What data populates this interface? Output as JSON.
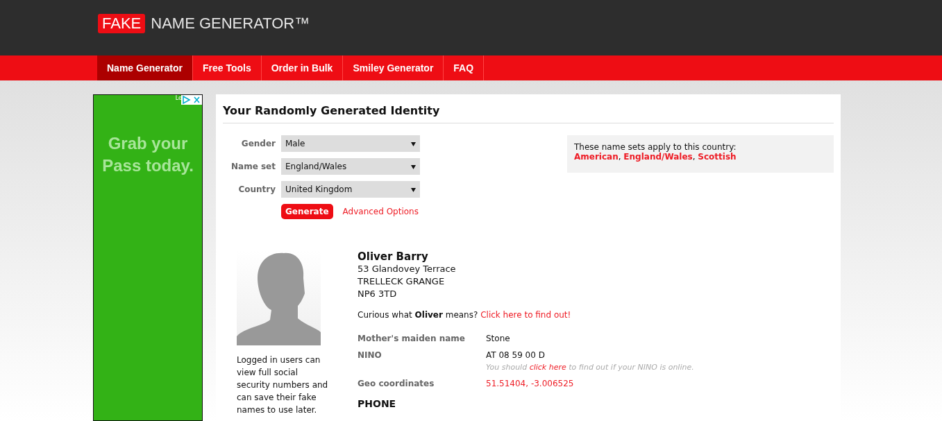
{
  "header": {
    "logo_badge": "FAKE",
    "logo_text": "NAME GENERATOR™"
  },
  "nav": [
    {
      "label": "Name Generator",
      "selected": true
    },
    {
      "label": "Free Tools",
      "selected": false
    },
    {
      "label": "Order in Bulk",
      "selected": false
    },
    {
      "label": "Smiley Generator",
      "selected": false
    },
    {
      "label": "FAQ",
      "selected": false
    }
  ],
  "ad": {
    "label": "Le",
    "headline": "Grab your Pass today."
  },
  "panel": {
    "title": "Your Randomly Generated Identity",
    "fields": [
      {
        "label": "Gender",
        "value": "Male"
      },
      {
        "label": "Name set",
        "value": "England/Wales"
      },
      {
        "label": "Country",
        "value": "United Kingdom"
      }
    ],
    "generate_button": "Generate",
    "advanced_link": "Advanced Options",
    "name_sets": {
      "intro": "These name sets apply to this country:",
      "links": [
        "American",
        "England/Wales",
        "Scottish"
      ],
      "separator": ", "
    },
    "identity": {
      "login_note": "Logged in users can view full social security numbers and can save their fake names to use later.",
      "name": "Oliver Barry",
      "address": [
        "53 Glandovey Terrace",
        "TRELLECK GRANGE",
        "NP6 3TD"
      ],
      "meaning_text": "Curious what **Oliver** means?",
      "meaning_link": "Click here to find out!",
      "details": [
        {
          "label": "Mother's maiden name",
          "value": "Stone",
          "kind": "plain"
        },
        {
          "label": "NINO",
          "value": "AT 08 59 00 D",
          "kind": "note",
          "note_before": "You should",
          "note_link": "click here",
          "note_after": "to find out if your NINO is online."
        },
        {
          "label": "Geo coordinates",
          "value": "51.51404, -3.006525",
          "kind": "link"
        }
      ],
      "section_heading": "PHONE"
    }
  }
}
